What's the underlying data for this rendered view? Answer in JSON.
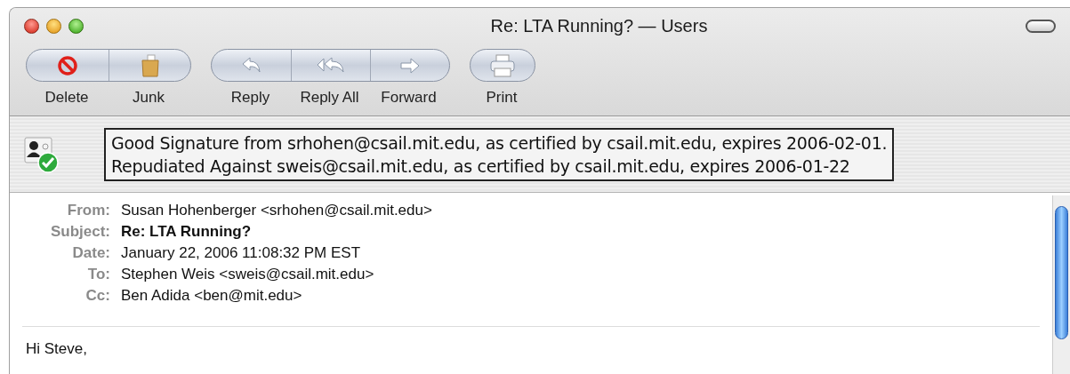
{
  "window": {
    "title": "Re: LTA Running? — Users"
  },
  "toolbar": {
    "groups": [
      {
        "buttons": [
          {
            "label": "Delete",
            "kind": "delete"
          },
          {
            "label": "Junk",
            "kind": "junk"
          }
        ]
      },
      {
        "buttons": [
          {
            "label": "Reply",
            "kind": "reply"
          },
          {
            "label": "Reply All",
            "kind": "reply_all"
          },
          {
            "label": "Forward",
            "kind": "forward"
          }
        ]
      },
      {
        "buttons": [
          {
            "label": "Print",
            "kind": "print"
          }
        ]
      }
    ]
  },
  "security": {
    "lines": [
      "Good Signature from srhohen@csail.mit.edu, as certified by csail.mit.edu, expires 2006-02-01.",
      "Repudiated Against sweis@csail.mit.edu, as certified by csail.mit.edu, expires 2006-01-22"
    ]
  },
  "headers": [
    {
      "label": "From:",
      "value": "Susan Hohenberger <srhohen@csail.mit.edu>",
      "bold": false
    },
    {
      "label": "Subject:",
      "value": "Re: LTA Running?",
      "bold": true
    },
    {
      "label": "Date:",
      "value": "January 22, 2006 11:08:32 PM EST",
      "bold": false
    },
    {
      "label": "To:",
      "value": "Stephen Weis <sweis@csail.mit.edu>",
      "bold": false
    },
    {
      "label": "Cc:",
      "value": "Ben Adida <ben@mit.edu>",
      "bold": false
    }
  ],
  "body": {
    "lines": [
      "Hi Steve,"
    ]
  }
}
